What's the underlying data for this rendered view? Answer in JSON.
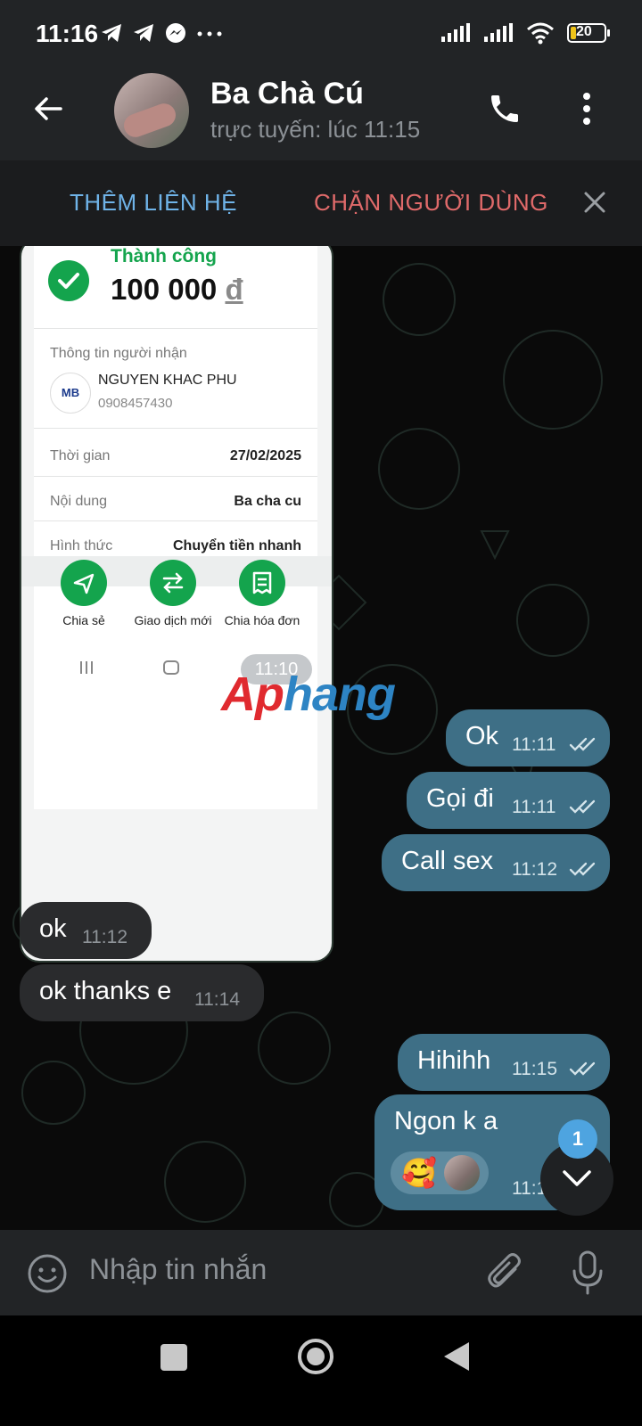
{
  "status_bar": {
    "time": "11:16",
    "battery": "20"
  },
  "header": {
    "contact_name": "Ba Chà Cú",
    "contact_status": "trực tuyến: lúc 11:15"
  },
  "actionbar": {
    "add_contact": "THÊM LIÊN HỆ",
    "block_user": "CHẶN NGƯỜI DÙNG"
  },
  "photo_message": {
    "receipt": {
      "status": "Thành công",
      "amount": "100 000",
      "currency": "đ",
      "recipient_label": "Thông tin người nhận",
      "bank": "MB",
      "recipient_name": "NGUYEN KHAC PHU",
      "recipient_phone": "0908457430",
      "rows": [
        {
          "label": "Thời gian",
          "value": "27/02/2025"
        },
        {
          "label": "Nội dung",
          "value": "Ba cha cu"
        },
        {
          "label": "Hình thức",
          "value": "Chuyển tiền nhanh"
        }
      ],
      "actions": [
        "Chia sẻ",
        "Giao dịch mới",
        "Chia hóa đơn"
      ]
    },
    "time": "11:10"
  },
  "watermark": {
    "part1": "Ap",
    "part2": "hang"
  },
  "messages": [
    {
      "dir": "out",
      "text": "Ok",
      "time": "11:11"
    },
    {
      "dir": "out",
      "text": "Gọi đi",
      "time": "11:11"
    },
    {
      "dir": "out",
      "text": "Call sex",
      "time": "11:12"
    },
    {
      "dir": "in",
      "text": "ok",
      "time": "11:12"
    },
    {
      "dir": "in",
      "text": "ok thanks e",
      "time": "11:14"
    },
    {
      "dir": "out",
      "text": "Hihihh",
      "time": "11:15"
    },
    {
      "dir": "out",
      "text": "Ngon k a",
      "time": "11:1",
      "reaction": "🥰"
    }
  ],
  "unread_count": "1",
  "input": {
    "placeholder": "Nhập tin nhắn"
  },
  "icons": [
    "back-arrow-icon",
    "phone-icon",
    "more-vert-icon",
    "close-icon",
    "emoji-icon",
    "attach-icon",
    "mic-icon",
    "chevron-down-icon"
  ]
}
